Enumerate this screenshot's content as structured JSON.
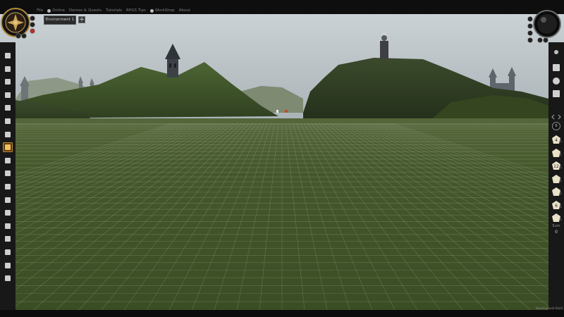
{
  "menu": {
    "items": [
      {
        "label": "File",
        "icon": ""
      },
      {
        "label": "Online",
        "icon": "globe-icon"
      },
      {
        "label": "Demos & Quests",
        "icon": ""
      },
      {
        "label": "Tutorials",
        "icon": ""
      },
      {
        "label": "RPGS Tips",
        "icon": ""
      },
      {
        "label": "WorkShop",
        "icon": "globe-icon"
      },
      {
        "label": "About",
        "icon": ""
      }
    ]
  },
  "tabs": [
    {
      "label": "Environment 1"
    }
  ],
  "add_tab_label": "+",
  "left_toolbar": {
    "tools": [
      {
        "name": "select-icon",
        "active": false
      },
      {
        "name": "paint-icon",
        "active": false
      },
      {
        "name": "layers-icon",
        "active": false
      },
      {
        "name": "terrain-icon",
        "active": false
      },
      {
        "name": "stairs-icon",
        "active": false
      },
      {
        "name": "fence-icon",
        "active": false
      },
      {
        "name": "wall-icon",
        "active": false
      },
      {
        "name": "tower-icon",
        "active": true
      },
      {
        "name": "door-icon",
        "active": false
      },
      {
        "name": "arch-icon",
        "active": false
      },
      {
        "name": "light-icon",
        "active": false
      },
      {
        "name": "brush-icon",
        "active": false
      },
      {
        "name": "compass-icon",
        "active": false
      },
      {
        "name": "map-icon",
        "active": false
      },
      {
        "name": "portal-icon",
        "active": false
      },
      {
        "name": "cube-icon",
        "active": false
      },
      {
        "name": "crown-icon",
        "active": false
      },
      {
        "name": "fire-icon",
        "active": false
      }
    ]
  },
  "dice": [
    {
      "name": "d4-icon",
      "label": "4",
      "count": "1"
    },
    {
      "name": "d6-icon",
      "label": "",
      "count": "1"
    },
    {
      "name": "d8-icon",
      "label": "12",
      "count": "1"
    },
    {
      "name": "d10-icon",
      "label": "",
      "count": "1"
    },
    {
      "name": "d12-icon",
      "label": "",
      "count": "1"
    },
    {
      "name": "d20-icon",
      "label": "6",
      "count": "1"
    },
    {
      "name": "d100-icon",
      "label": "",
      "count": "1"
    }
  ],
  "dice_sum": {
    "label": "Sum",
    "value": "0"
  },
  "build_label": "Development Build",
  "colors": {
    "accent": "#c58a2a",
    "grass": "#3e5227",
    "sky": "#b9c2c7"
  }
}
